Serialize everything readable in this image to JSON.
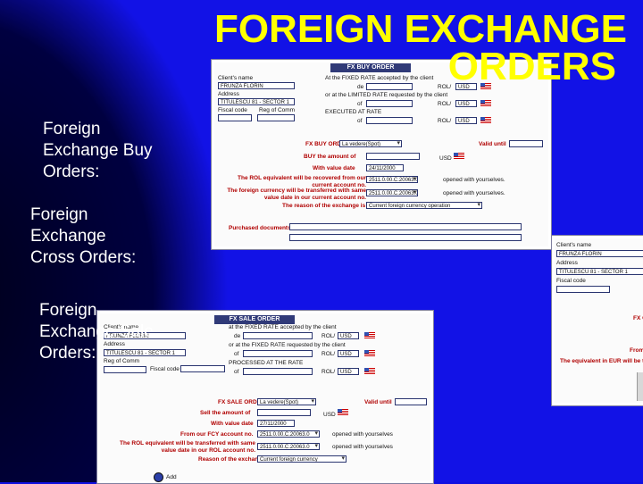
{
  "title_line1": "FOREIGN EXCHANGE",
  "title_line2": "ORDERS",
  "bullets": [
    "Foreign Exchange Buy Orders:",
    "Foreign Exchange Cross Orders:",
    "Foreign Exchange Sale Orders:"
  ],
  "buy_form": {
    "header": "FX BUY ORDER",
    "clients_name_label": "Client's name",
    "clients_name": "FRUNZA FLORIN",
    "address_label": "Address",
    "address": "TITULESCU 81 - SECTOR 1",
    "fiscal_code_label": "Fiscal code",
    "reg_label": "Reg of Comm",
    "fixed_rate_label": "At the FIXED RATE accepted by the client",
    "limited_rate_label": "or at the LIMITED RATE requested by the client",
    "executed_label": "EXECUTED AT RATE",
    "de": "de",
    "of": "of",
    "rol_label": "ROL/",
    "usd": "USD",
    "fx_buy_order_label": "FX BUY ORDER",
    "order_type": "La vedere(Spot)",
    "valid_until_label": "Valid until",
    "buy_amount_label": "BUY the amount of",
    "with_value_date_label": "With value date",
    "value_date": "24/11/2000",
    "rol_equiv_label": "The ROL equivalent will be recovered from our current account no.",
    "account_rol": "2511.0.00.C.20063.0",
    "opened_label": "opened with yourselves.",
    "fx_transfer_label": "The foreign currency will be transferred with same value date in our current account no.",
    "account_fx": "2511.0.00.C.20063.0",
    "reason_label": "The reason of the exchange is",
    "reason": "Current foreign currency operation",
    "purchased_label": "Purchased documents"
  },
  "cross_form": {
    "clients_name_label": "Client's name",
    "clients_name": "FRUNZA FLORIN",
    "address_label": "Address",
    "address": "TITULESCU 81 - SECTOR 1",
    "fiscal_code_label": "Fiscal code",
    "fx_label": "FX CR",
    "from_label": "From",
    "equiv_label": "The equivalent in EUR will be tr"
  },
  "sale_form": {
    "header": "FX SALE ORDER",
    "clients_name_label": "Client's name",
    "clients_name": "FRUNZA FLORIN",
    "address_label": "Address",
    "address": "TITULESCU 81 - SECTOR 1",
    "reg_label": "Reg of Comm",
    "fiscal_code_label": "Fiscal code",
    "fixed_rate_label": "at the FIXED RATE accepted by the client",
    "fixed_rate2_label": "or at the FIXED RATE requested by the client",
    "processed_label": "PROCESSED AT THE RATE",
    "de": "de",
    "of": "of",
    "rol_label": "ROL/",
    "usd": "USD",
    "fx_sale_order_label": "FX SALE ORDER",
    "order_type": "La vedere(Spot)",
    "valid_until_label": "Valid until",
    "sell_amount_label": "Sell the amount of",
    "with_value_date_label": "With value date",
    "value_date": "27/11/2000",
    "from_account_label": "From our FCY account no.",
    "account_fcy": "2511.0.00.C.20063.0",
    "opened_label": "opened with yourselves",
    "rol_equiv_label": "The ROL equivalent will be transferred with same value date in our ROL account no.",
    "account_rol": "2511.0.00.C.20063.0",
    "reason_label": "Reason of the exchange",
    "reason": "Current foreign currency",
    "add_label": "Add"
  },
  "colors": {
    "background": "#1212e6",
    "title": "#ffff00",
    "bullet_text": "#ffffff",
    "form_header": "#303a78"
  }
}
